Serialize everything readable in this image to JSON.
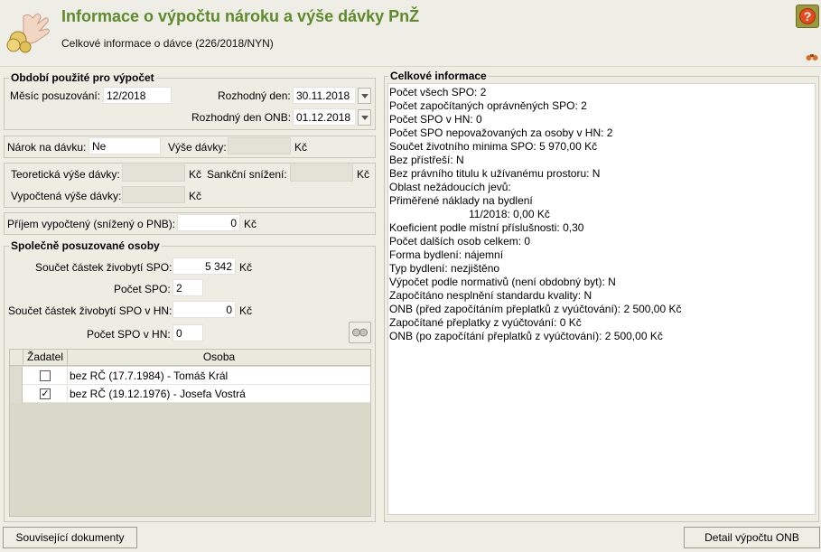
{
  "header": {
    "title": "Informace o výpočtu nároku a výše dávky PnŽ",
    "subtitle": "Celkové informace o dávce (226/2018/NYN)",
    "help_label": "?"
  },
  "period": {
    "legend": "Období použité pro výpočet",
    "month_label": "Měsíc posuzování:",
    "month_value": "12/2018",
    "decision_day_label": "Rozhodný den:",
    "decision_day_value": "30.11.2018",
    "decision_onb_label": "Rozhodný den ONB:",
    "decision_onb_value": "01.12.2018"
  },
  "claim": {
    "claim_label": "Nárok na dávku:",
    "claim_value": "Ne",
    "amount_label": "Výše dávky:",
    "amount_value": "",
    "currency": "Kč"
  },
  "theory": {
    "theoretical_label": "Teoretická výše dávky:",
    "theoretical_value": "",
    "sanction_label": "Sankční snížení:",
    "sanction_value": "",
    "computed_label": "Vypočtená výše dávky:",
    "computed_value": "",
    "currency": "Kč"
  },
  "income": {
    "label": "Příjem vypočtený (snížený o PNB):",
    "value": "0",
    "currency": "Kč"
  },
  "joint": {
    "legend": "Společně posuzované osoby",
    "sum_living_label": "Součet částek živobytí SPO:",
    "sum_living_value": "5 342",
    "count_label": "Počet SPO:",
    "count_value": "2",
    "sum_living_hn_label": "Součet částek živobytí SPO v HN:",
    "sum_living_hn_value": "0",
    "count_hn_label": "Počet SPO v HN:",
    "count_hn_value": "0",
    "currency": "Kč",
    "table": {
      "headers": [
        "Žadatel",
        "Osoba"
      ],
      "rows": [
        {
          "applicant": false,
          "mark": "",
          "person": "bez RČ (17.7.1984) - Tomáš Král"
        },
        {
          "applicant": true,
          "mark": "✓",
          "person": "bez RČ (19.12.1976) - Josefa Vostrá"
        }
      ]
    }
  },
  "summary": {
    "legend": "Celkové informace",
    "lines": [
      "Počet všech SPO: 2",
      "Počet započítaných oprávněných SPO: 2",
      "Počet SPO v HN: 0",
      "Počet SPO nepovažovaných za osoby v HN: 2",
      "Součet životního minima SPO: 5 970,00 Kč",
      "Bez přístřeší: N",
      "Bez právního titulu k užívanému prostoru: N",
      "Oblast nežádoucích jevů:",
      "Přiměřené náklady na bydlení",
      "11/2018: 0,00 Kč",
      "Koeficient podle místní příslušnosti: 0,30",
      "Počet dalších osob celkem: 0",
      "Forma bydlení: nájemní",
      "Typ bydlení: nezjištěno",
      "Výpočet podle normativů (není obdobný byt): N",
      "Započítáno nesplnění standardu kvality: N",
      "ONB (před započítáním přeplatků z vyúčtování): 2 500,00 Kč",
      "Započítané přeplatky z vyúčtování: 0 Kč",
      "ONB (po započítání přeplatků z vyúčtování): 2 500,00 Kč"
    ]
  },
  "buttons": {
    "related_docs": "Související dokumenty",
    "onb_detail": "Detail výpočtu ONB"
  }
}
